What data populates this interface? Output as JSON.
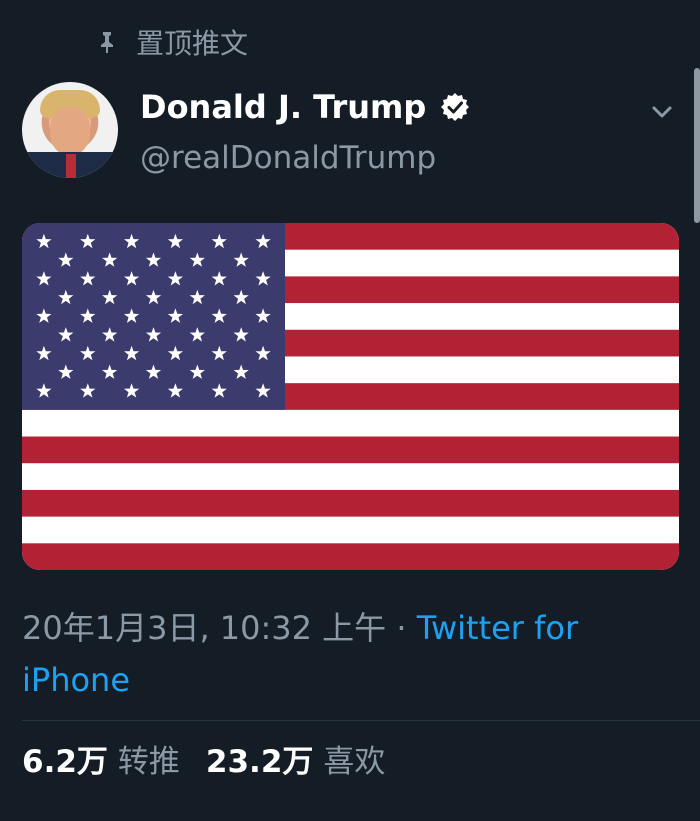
{
  "header": {
    "pinned_label": "置顶推文",
    "pin_icon": "pin-icon",
    "menu_icon": "chevron-down-icon"
  },
  "user": {
    "display_name": "Donald J. Trump",
    "handle": "@realDonaldTrump",
    "verified": true,
    "avatar_icon": "avatar"
  },
  "tweet": {
    "media": "us-flag-image",
    "timestamp": "20年1月3日, 10:32 上午 · ",
    "client": "Twitter for iPhone"
  },
  "stats": {
    "retweets": "6.2万",
    "retweets_label": "转推",
    "likes": "23.2万",
    "likes_label": "喜欢"
  },
  "colors": {
    "background": "#141d26",
    "muted": "#8b98a5",
    "link": "#1da1f2",
    "flag_red": "#b22234",
    "flag_blue": "#3c3b6e"
  }
}
